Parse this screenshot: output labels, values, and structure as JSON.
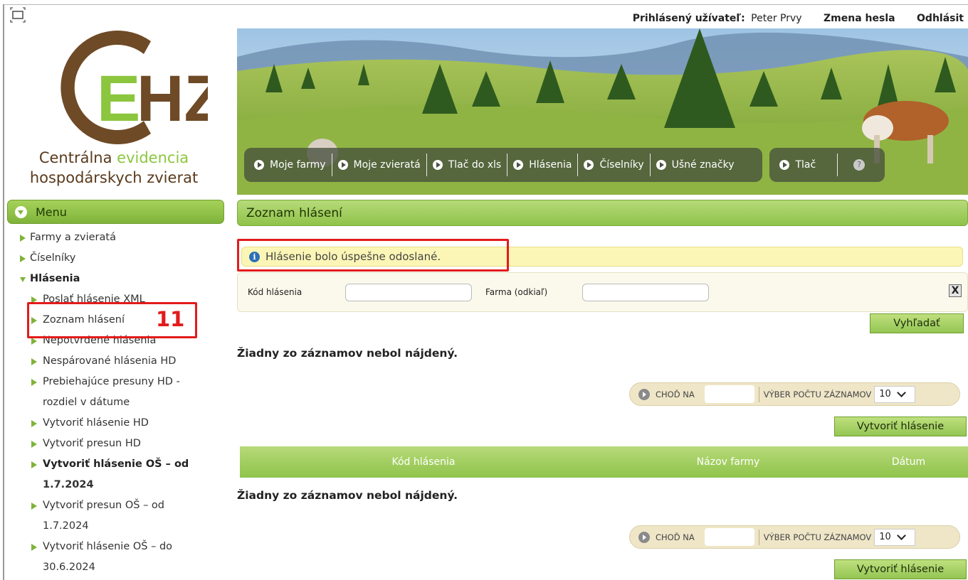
{
  "topbar": {
    "user_label": "Prihlásený užívateľ:",
    "user_name": "Peter Prvy",
    "change_password": "Zmena hesla",
    "logout": "Odhlásit"
  },
  "logo": {
    "letters": "EHZ",
    "tagline_line1_a": "Centrálna",
    "tagline_line1_b": "evidencia",
    "tagline_line2": "hospodárskych zvierat"
  },
  "nav": {
    "group1": [
      "Moje farmy",
      "Moje zvieratá",
      "Tlač do xls",
      "Hlásenia",
      "Číselníky",
      "Ušné značky"
    ],
    "group2": [
      "Tlač"
    ],
    "help": "?"
  },
  "sidebar": {
    "menu_title": "Menu",
    "items": [
      {
        "label": "Farmy a zvieratá"
      },
      {
        "label": "Číselníky"
      },
      {
        "label": "Hlásenia"
      }
    ],
    "sub_items": [
      "Poslať hlásenie XML",
      "Zoznam hlásení",
      "Nepotvrdené hlásenia",
      "Nespárované hlásenia HD",
      "Prebiehajúce presuny HD -",
      "rozdiel v dátume",
      "Vytvoriť hlásenie HD",
      "Vytvoriť presun HD",
      "Vytvoriť hlásenie OŠ – od",
      "1.7.2024",
      "Vytvoriť presun OŠ – od",
      "1.7.2024",
      "Vytvoriť hlásenie OŠ – do",
      "30.6.2024"
    ],
    "annotation_number": "11"
  },
  "main": {
    "section_title": "Zoznam hlásení",
    "info_message": "Hlásenie bolo úspešne odoslané.",
    "filter": {
      "code_label": "Kód hlásenia",
      "code_value": "",
      "farm_label": "Farma (odkiaľ)",
      "farm_value": "",
      "close": "X"
    },
    "search_button": "Vyhľadať",
    "empty_text": "Žiadny zo záznamov nebol nájdený.",
    "pager": {
      "goto_label": "CHOĎ NA",
      "count_label": "VÝBER POČTU ZÁZNAMOV",
      "count_value": "10"
    },
    "create_button": "Vytvoriť hlásenie",
    "table": {
      "columns": [
        "Kód hlásenia",
        "Názov farmy",
        "Dátum"
      ]
    }
  },
  "colors": {
    "accent_green": "#8fc34a",
    "annotation_red": "#e31b1b",
    "info_yellow": "#fcf6b6"
  }
}
